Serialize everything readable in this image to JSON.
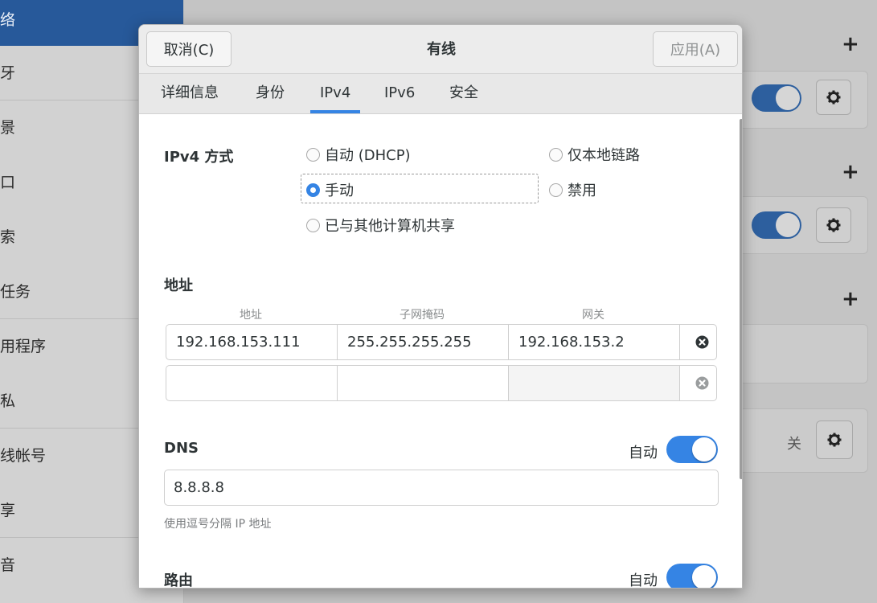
{
  "background": {
    "sidebar_items": [
      {
        "label": "络",
        "active": true
      },
      {
        "label": "牙"
      },
      {
        "label": "景"
      },
      {
        "label": "口"
      },
      {
        "label": "索"
      },
      {
        "label": "任务"
      },
      {
        "label": "用程序"
      },
      {
        "label": "私"
      },
      {
        "label": "线帐号"
      },
      {
        "label": "享"
      },
      {
        "label": "音"
      }
    ],
    "off_label": "关"
  },
  "dialog": {
    "title": "有线",
    "cancel_label": "取消(C)",
    "apply_label": "应用(A)",
    "tabs": [
      {
        "label": "详细信息"
      },
      {
        "label": "身份"
      },
      {
        "label": "IPv4",
        "active": true
      },
      {
        "label": "IPv6"
      },
      {
        "label": "安全"
      }
    ],
    "ipv4_method": {
      "label": "IPv4 方式",
      "options": {
        "auto": "自动 (DHCP)",
        "link_local": "仅本地链路",
        "manual": "手动",
        "disable": "禁用",
        "shared": "已与其他计算机共享"
      },
      "selected": "manual"
    },
    "address": {
      "label": "地址",
      "columns": [
        "地址",
        "子网掩码",
        "网关"
      ],
      "rows": [
        {
          "address": "192.168.153.111",
          "netmask": "255.255.255.255",
          "gateway": "192.168.153.2"
        },
        {
          "address": "",
          "netmask": "",
          "gateway": ""
        }
      ]
    },
    "dns": {
      "label": "DNS",
      "auto_label": "自动",
      "auto_enabled": true,
      "value": "8.8.8.8",
      "hint": "使用逗号分隔 IP 地址"
    },
    "routes": {
      "label": "路由",
      "auto_label": "自动",
      "auto_enabled": true
    }
  },
  "colors": {
    "accent": "#3584e4",
    "sidebar_active": "#27599a"
  }
}
